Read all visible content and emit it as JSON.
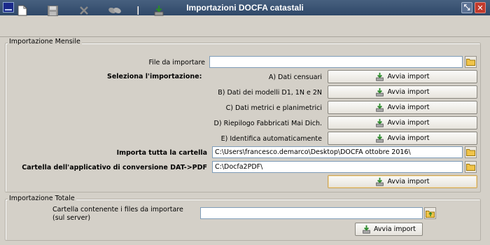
{
  "window": {
    "title": "Importazioni DOCFA catastali",
    "restore_glyph": "⤡",
    "close_glyph": "✕"
  },
  "toolbar": {
    "icons": [
      "new-document-icon",
      "save-icon",
      "delete-icon",
      "link-icon",
      "import-icon"
    ]
  },
  "monthly": {
    "legend": "Importazione Mensile",
    "file_label": "File da importare",
    "file_value": "",
    "select_label": "Seleziona l'importazione:",
    "options": [
      {
        "label": "A) Dati censuari",
        "button": "Avvia import"
      },
      {
        "label": "B) Dati dei modelli D1, 1N e 2N",
        "button": "Avvia import"
      },
      {
        "label": "C) Dati metrici e planimetrici",
        "button": "Avvia import"
      },
      {
        "label": "D) Riepilogo Fabbricati Mai Dich.",
        "button": "Avvia import"
      },
      {
        "label": "E) Identifica automaticamente",
        "button": "Avvia import"
      }
    ],
    "folder_label": "Importa tutta la cartella",
    "folder_value": "C:\\Users\\francesco.demarco\\Desktop\\DOCFA ottobre 2016\\",
    "converter_label": "Cartella dell'applicativo di conversione DAT->PDF",
    "converter_value": "C:\\Docfa2PDF\\",
    "run_button": "Avvia import"
  },
  "total": {
    "legend": "Importazione Totale",
    "folder_label_1": "Cartella contenente i files da importare",
    "folder_label_2": "(sul server)",
    "folder_value": "",
    "run_button": "Avvia import"
  },
  "colors": {
    "titlebar": "#3b5475",
    "window": "#d4d0c8",
    "input_border": "#7f9db9",
    "focus_border": "#c9a45c"
  }
}
